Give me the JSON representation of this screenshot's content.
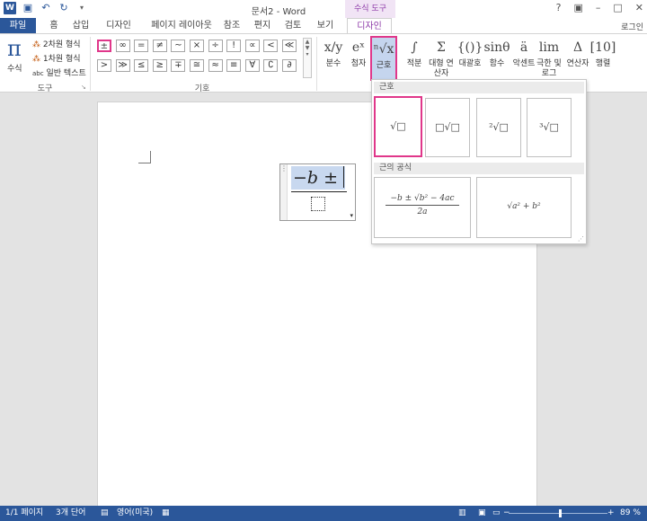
{
  "window": {
    "title": "문서2 - Word",
    "context_tool": "수식 도구",
    "min": "?",
    "restore": "□",
    "close": "✕",
    "help": "?"
  },
  "qat": {
    "word_icon": "W",
    "save_icon": "save-icon",
    "undo_icon": "undo-icon",
    "redo_icon": "redo-icon"
  },
  "tabs": {
    "file": "파일",
    "items": [
      "홈",
      "삽입",
      "디자인",
      "페이지 레이아웃",
      "참조",
      "편지",
      "검토",
      "보기",
      "디자인"
    ],
    "login": "로그인"
  },
  "ribbon": {
    "tools": {
      "equation_label": "수식",
      "pi": "π",
      "item_2d": "2차원 형식",
      "item_1d": "1차원 형식",
      "item_text": "일반 텍스트",
      "group_label": "도구"
    },
    "symbols": {
      "row1": [
        "±",
        "∞",
        "=",
        "≠",
        "~",
        "×",
        "÷",
        "!",
        "∝",
        "<",
        "≪"
      ],
      "row2": [
        ">",
        "≫",
        "≤",
        "≥",
        "∓",
        "≅",
        "≈",
        "≡",
        "∀",
        "∁",
        "∂"
      ],
      "group_label": "기호"
    },
    "structures": [
      {
        "glyph": "x/y",
        "label": "분수"
      },
      {
        "glyph": "eˣ",
        "label": "첨자"
      },
      {
        "glyph": "ⁿ√x",
        "label": "근호"
      },
      {
        "glyph": "∫",
        "label": "적분"
      },
      {
        "glyph": "Σ",
        "label": "대형 연산자"
      },
      {
        "glyph": "{()}",
        "label": "대괄호"
      },
      {
        "glyph": "sinθ",
        "label": "함수"
      },
      {
        "glyph": "ä",
        "label": "악센트"
      },
      {
        "glyph": "lim",
        "label": "극한 및 로그"
      },
      {
        "glyph": "Δ",
        "label": "연산자"
      },
      {
        "glyph": "[10]",
        "label": "행렬"
      }
    ]
  },
  "equation": {
    "numerator": "−b ±",
    "handle": "⋮",
    "drop": "▾"
  },
  "radical_panel": {
    "section1": "근호",
    "section2": "근의 공식",
    "tiles": [
      "√□",
      "□√□",
      "²√□",
      "³√□"
    ],
    "formula_quad": "−b ± √b² − 4ac",
    "formula_quad_den": "2a",
    "formula_pyth": "√a² + b²"
  },
  "status": {
    "page": "1/1 페이지",
    "words": "3개 단어",
    "lang": "영어(미국)",
    "zoom": "89 %",
    "zoom_minus": "−",
    "zoom_plus": "+"
  }
}
